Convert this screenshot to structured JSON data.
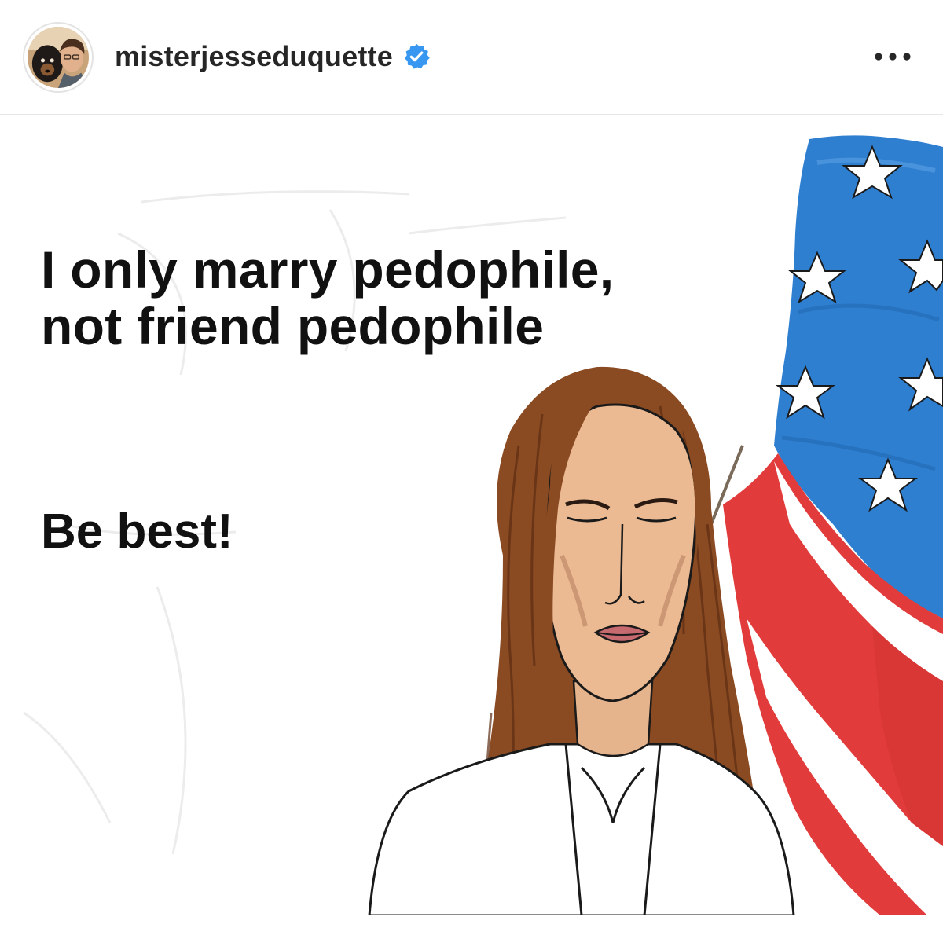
{
  "post": {
    "author": {
      "username": "misterjesseduquette",
      "verified": true,
      "avatar_icon": "avatar-photo-icon",
      "verified_icon": "verified-badge-icon"
    },
    "menu_icon": "more-options-icon",
    "image": {
      "caption_line_1": "I only marry pedophile,",
      "caption_line_2": "not friend pedophile",
      "caption_tagline": "Be best!"
    }
  },
  "colors": {
    "verified_blue": "#3897f0",
    "text_dark": "#262626",
    "flag_blue": "#2f7fd0",
    "flag_red": "#e23b3b",
    "hair_brown": "#8a4a22"
  }
}
